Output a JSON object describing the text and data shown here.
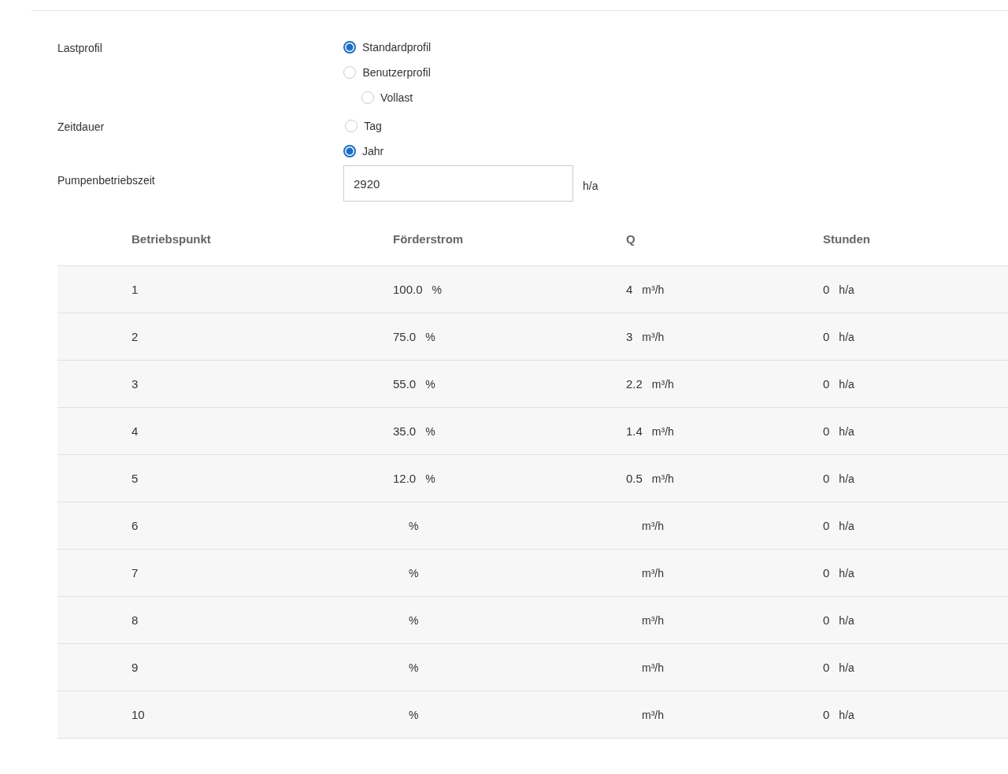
{
  "form": [
    {
      "label": "Lastprofil",
      "kind": "radio",
      "options": [
        {
          "label": "Standardprofil",
          "selected": true
        },
        {
          "label": "Benutzerprofil",
          "selected": false
        },
        {
          "label": "Vollast",
          "selected": false
        }
      ]
    },
    {
      "label": "Zeitdauer",
      "kind": "radio",
      "options": [
        {
          "label": "Tag",
          "selected": false
        },
        {
          "label": "Jahr",
          "selected": true
        }
      ]
    },
    {
      "label": "Pumpenbetriebszeit",
      "kind": "input",
      "value": "2920",
      "unit": "h/a"
    }
  ],
  "table": {
    "columns": [
      "Betriebspunkt",
      "Förderstrom",
      "Q",
      "Stunden"
    ],
    "rows": [
      {
        "point": "1",
        "flow": {
          "value": "100.0",
          "unit": "%"
        },
        "q": {
          "value": "4",
          "unit": "m³/h"
        },
        "hours": {
          "value": "0",
          "unit": "h/a"
        }
      },
      {
        "point": "2",
        "flow": {
          "value": "75.0",
          "unit": "%"
        },
        "q": {
          "value": "3",
          "unit": "m³/h"
        },
        "hours": {
          "value": "0",
          "unit": "h/a"
        }
      },
      {
        "point": "3",
        "flow": {
          "value": "55.0",
          "unit": "%"
        },
        "q": {
          "value": "2.2",
          "unit": "m³/h"
        },
        "hours": {
          "value": "0",
          "unit": "h/a"
        }
      },
      {
        "point": "4",
        "flow": {
          "value": "35.0",
          "unit": "%"
        },
        "q": {
          "value": "1.4",
          "unit": "m³/h"
        },
        "hours": {
          "value": "0",
          "unit": "h/a"
        }
      },
      {
        "point": "5",
        "flow": {
          "value": "12.0",
          "unit": "%"
        },
        "q": {
          "value": "0.5",
          "unit": "m³/h"
        },
        "hours": {
          "value": "0",
          "unit": "h/a"
        }
      },
      {
        "point": "6",
        "flow": {
          "unit": "%"
        },
        "q": {
          "unit": "m³/h"
        },
        "hours": {
          "value": "0",
          "unit": "h/a"
        }
      },
      {
        "point": "7",
        "flow": {
          "unit": "%"
        },
        "q": {
          "unit": "m³/h"
        },
        "hours": {
          "value": "0",
          "unit": "h/a"
        }
      },
      {
        "point": "8",
        "flow": {
          "unit": "%"
        },
        "q": {
          "unit": "m³/h"
        },
        "hours": {
          "value": "0",
          "unit": "h/a"
        }
      },
      {
        "point": "9",
        "flow": {
          "unit": "%"
        },
        "q": {
          "unit": "m³/h"
        },
        "hours": {
          "value": "0",
          "unit": "h/a"
        }
      },
      {
        "point": "10",
        "flow": {
          "unit": "%"
        },
        "q": {
          "unit": "m³/h"
        },
        "hours": {
          "value": "0",
          "unit": "h/a"
        }
      }
    ]
  }
}
